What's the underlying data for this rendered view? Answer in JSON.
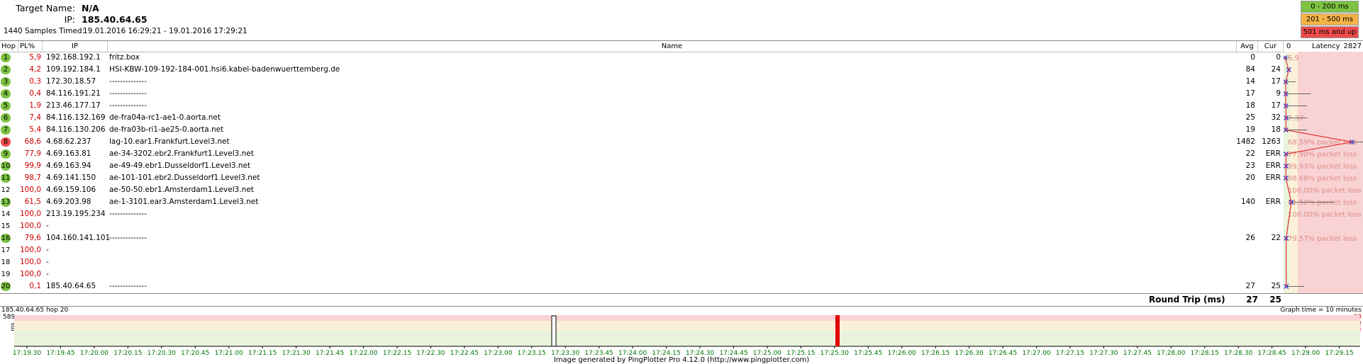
{
  "header": {
    "target_label": "Target Name:",
    "target_value": "N/A",
    "ip_label": "IP:",
    "ip_value": "185.40.64.65",
    "samples_label": "1440 Samples Timed:",
    "samples_value": "19.01.2016 16:29:21 - 19.01.2016 17:29:21"
  },
  "legend": [
    {
      "label": "0 - 200 ms",
      "color": "#7dc242"
    },
    {
      "label": "201 - 500 ms",
      "color": "#f5b347"
    },
    {
      "label": "501 ms and up",
      "color": "#f04b4b"
    }
  ],
  "columns": {
    "hop": "Hop",
    "pl": "PL%",
    "ip": "IP",
    "name": "Name",
    "avg": "Avg",
    "cur": "Cur",
    "graph_zero": "0",
    "latency": "Latency",
    "max": "2827 ms"
  },
  "rows": [
    {
      "hop": "1",
      "pl": "5,9",
      "ip": "192.168.192.1",
      "name": "fritz.box",
      "avg": "0",
      "cur": "0",
      "badge": "#7dc242",
      "loss": "5,9",
      "lat": 0,
      "err": 6
    },
    {
      "hop": "2",
      "pl": "4,2",
      "ip": "109.192.184.1",
      "name": "HSI-KBW-109-192-184-001.hsi6.kabel-badenwuerttemberg.de",
      "avg": "84",
      "cur": "24",
      "badge": "#7dc242",
      "loss": "",
      "lat": 84,
      "err": 0
    },
    {
      "hop": "3",
      "pl": "0,3",
      "ip": "172.30.18.57",
      "name": "--------------",
      "avg": "14",
      "cur": "17",
      "badge": "#7dc242",
      "loss": "",
      "lat": 14,
      "err": 14
    },
    {
      "hop": "4",
      "pl": "0,4",
      "ip": "84.116.191.21",
      "name": "--------------",
      "avg": "17",
      "cur": "9",
      "badge": "#7dc242",
      "loss": "",
      "lat": 17,
      "err": 35
    },
    {
      "hop": "5",
      "pl": "1,9",
      "ip": "213.46.177.17",
      "name": "--------------",
      "avg": "18",
      "cur": "17",
      "badge": "#7dc242",
      "loss": "",
      "lat": 18,
      "err": 30
    },
    {
      "hop": "6",
      "pl": "7,4",
      "ip": "84.116.132.169",
      "name": "de-fra04a-rc1-ae1-0.aorta.net",
      "avg": "25",
      "cur": "32",
      "badge": "#7dc242",
      "loss": "7,37",
      "lat": 25,
      "err": 30
    },
    {
      "hop": "7",
      "pl": "5,4",
      "ip": "84.116.130.206",
      "name": "de-fra03b-ri1-ae25-0.aorta.net",
      "avg": "19",
      "cur": "18",
      "badge": "#7dc242",
      "loss": "",
      "lat": 19,
      "err": 30
    },
    {
      "hop": "8",
      "pl": "68,6",
      "ip": "4.68.62.237",
      "name": "lag-10.ear1.Frankfurt.Level3.net",
      "avg": "1482",
      "cur": "1263",
      "badge": "#f04b4b",
      "loss": "68,59% packet loss",
      "lat": 1482,
      "err": 60
    },
    {
      "hop": "9",
      "pl": "77,9",
      "ip": "4.69.163.81",
      "name": "ae-34-3202.ebr2.Frankfurt1.Level3.net",
      "avg": "22",
      "cur": "ERR",
      "badge": "#7dc242",
      "loss": "77,90% packet loss",
      "lat": 22,
      "err": 0
    },
    {
      "hop": "10",
      "pl": "99,9",
      "ip": "4.69.163.94",
      "name": "ae-49-49.ebr1.Dusseldorf1.Level3.net",
      "avg": "23",
      "cur": "ERR",
      "badge": "#7dc242",
      "loss": "99,93% packet loss",
      "lat": 23,
      "err": 0
    },
    {
      "hop": "11",
      "pl": "98,7",
      "ip": "4.69.141.150",
      "name": "ae-101-101.ebr2.Dusseldorf1.Level3.net",
      "avg": "20",
      "cur": "ERR",
      "badge": "#7dc242",
      "loss": "98,68% packet loss",
      "lat": 20,
      "err": 0
    },
    {
      "hop": "12",
      "pl": "100,0",
      "ip": "4.69.159.106",
      "name": "ae-50-50.ebr1.Amsterdam1.Level3.net",
      "avg": "",
      "cur": "",
      "badge": "",
      "loss": "100,00% packet loss",
      "lat": null,
      "err": 0
    },
    {
      "hop": "13",
      "pl": "61,5",
      "ip": "4.69.203.98",
      "name": "ae-1-3101.ear3.Amsterdam1.Level3.net",
      "avg": "140",
      "cur": "ERR",
      "badge": "#7dc242",
      "loss": "61,50% packet loss",
      "lat": 140,
      "err": 60
    },
    {
      "hop": "14",
      "pl": "100,0",
      "ip": "213.19.195.234",
      "name": "--------------",
      "avg": "",
      "cur": "",
      "badge": "",
      "loss": "100,00% packet loss",
      "lat": null,
      "err": 0
    },
    {
      "hop": "15",
      "pl": "100,0",
      "ip": "-",
      "name": "",
      "avg": "",
      "cur": "",
      "badge": "",
      "loss": "",
      "lat": null,
      "err": 0
    },
    {
      "hop": "16",
      "pl": "79,6",
      "ip": "104.160.141.101",
      "name": "--------------",
      "avg": "26",
      "cur": "22",
      "badge": "#7dc242",
      "loss": "79,57% packet loss",
      "lat": 26,
      "err": 0
    },
    {
      "hop": "17",
      "pl": "100,0",
      "ip": "-",
      "name": "",
      "avg": "",
      "cur": "",
      "badge": "",
      "loss": "",
      "lat": null,
      "err": 0
    },
    {
      "hop": "18",
      "pl": "100,0",
      "ip": "-",
      "name": "",
      "avg": "",
      "cur": "",
      "badge": "",
      "loss": "",
      "lat": null,
      "err": 0
    },
    {
      "hop": "19",
      "pl": "100,0",
      "ip": "-",
      "name": "",
      "avg": "",
      "cur": "",
      "badge": "",
      "loss": "",
      "lat": null,
      "err": 0
    },
    {
      "hop": "20",
      "pl": "0,1",
      "ip": "185.40.64.65",
      "name": "--------------",
      "avg": "27",
      "cur": "25",
      "badge": "#7dc242",
      "loss": "",
      "lat": 27,
      "err": 25
    }
  ],
  "round_trip": {
    "label": "Round Trip (ms)",
    "avg": "27",
    "cur": "25"
  },
  "timeline": {
    "title": "185.40.64.65 hop 20",
    "graph_time": "Graph time = 10 minutes",
    "y_max": "589",
    "y_unit": "ms",
    "pl_max": "30",
    "pl_unit": "PL%",
    "ticks": [
      "17:19.30",
      "17:19.45",
      "17:20.00",
      "17:20.15",
      "17:20.30",
      "17:20.45",
      "17:21.00",
      "17:21.15",
      "17:21.30",
      "17:21.45",
      "17:22.00",
      "17:22.15",
      "17:22.30",
      "17:22.45",
      "17:23.00",
      "17:23.15",
      "17:23.30",
      "17:23.45",
      "17:24.00",
      "17:24.15",
      "17:24.30",
      "17:24.45",
      "17:25.00",
      "17:25.15",
      "17:25.30",
      "17:25.45",
      "17:26.00",
      "17:26.15",
      "17:26.30",
      "17:26.45",
      "17:27.00",
      "17:27.15",
      "17:27.30",
      "17:27.45",
      "17:28.00",
      "17:28.15",
      "17:28.30",
      "17:28.45",
      "17:29.00",
      "17:29.15"
    ],
    "footer": "Image generated by PingPlotter Pro 4.12.0 (http://www.pingplotter.com)"
  }
}
